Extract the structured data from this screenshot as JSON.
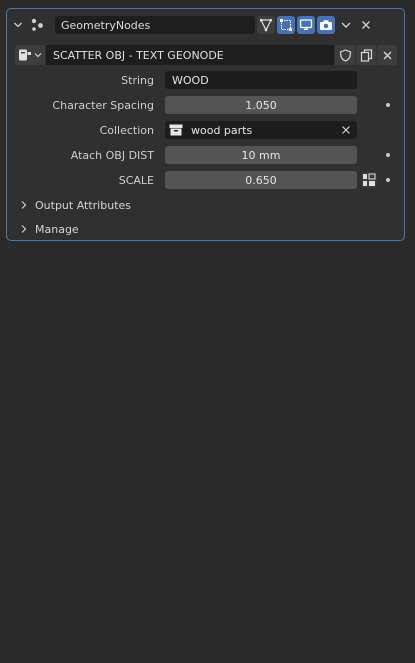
{
  "modifier": {
    "name": "GeometryNodes",
    "node_group": "SCATTER OBJ - TEXT GEONODE"
  },
  "properties": [
    {
      "label": "String",
      "value": "WOOD",
      "kind": "text"
    },
    {
      "label": "Character Spacing",
      "value": "1.050",
      "kind": "number"
    },
    {
      "label": "Collection",
      "value": "wood parts",
      "kind": "collection"
    },
    {
      "label": "Atach OBJ DIST",
      "value": "10 mm",
      "kind": "number"
    },
    {
      "label": "SCALE",
      "value": "0.650",
      "kind": "number"
    }
  ],
  "sections": {
    "output_attributes": "Output Attributes",
    "manage": "Manage"
  },
  "colors": {
    "accent": "#4772b3",
    "panel_border": "#4a77b4",
    "background": "#2b2b2b",
    "panel": "#303030"
  },
  "icons": {
    "collapse": "chevron-down-icon",
    "modifier": "geometry-nodes-icon",
    "edit_mode": "edit-mode-icon",
    "cage": "on-cage-icon",
    "viewport": "viewport-display-icon",
    "render": "camera-render-icon",
    "menu": "chevron-down-icon",
    "remove": "close-icon",
    "fake_user": "shield-icon",
    "duplicate": "duplicate-icon",
    "unlink": "close-icon",
    "collection": "collection-box-icon",
    "attribute": "attribute-toggle-icon",
    "expand": "chevron-right-icon"
  }
}
